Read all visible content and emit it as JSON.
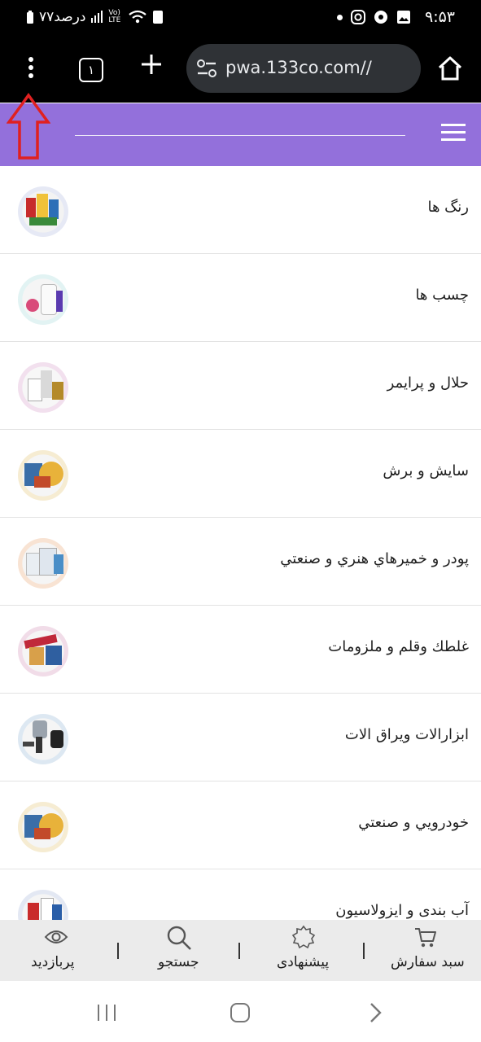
{
  "status_bar": {
    "time": "۹:۵۳",
    "battery": "۷۷درصد",
    "network": "Vo) LTE"
  },
  "browser": {
    "url": "pwa.133co.com//",
    "tab_count": "۱",
    "icons": [
      "menu-dots-icon",
      "tab-switcher-icon",
      "plus-icon",
      "site-settings-icon",
      "home-icon"
    ]
  },
  "annotation": {
    "color": "#e02020",
    "icon": "arrow-up-outline"
  },
  "header": {
    "background": "#9370db"
  },
  "categories": [
    {
      "label": "رنگ ها",
      "thumb": "paint-products"
    },
    {
      "label": "چسب ها",
      "thumb": "glue-products"
    },
    {
      "label": "حلال و پرايمر",
      "thumb": "solvent-primer"
    },
    {
      "label": "سايش و برش",
      "thumb": "abrasive-discs"
    },
    {
      "label": "پودر و خميرهاي هنري و صنعتي",
      "thumb": "powder-putty"
    },
    {
      "label": "غلطك وقلم و ملزومات",
      "thumb": "roller-brush"
    },
    {
      "label": "ابزارالات ويراق الات",
      "thumb": "tools-spraygun"
    },
    {
      "label": "خودرويي و صنعتي",
      "thumb": "automotive-abrasive"
    },
    {
      "label": "آب بندی و ايزولاسيون",
      "thumb": "sealants"
    }
  ],
  "bottom_nav": [
    {
      "label": "سبد سفارش",
      "icon": "cart-icon"
    },
    {
      "label": "پيشنهادی",
      "icon": "badge-icon"
    },
    {
      "label": "جستجو",
      "icon": "search-icon"
    },
    {
      "label": "پربازديد",
      "icon": "eye-icon"
    }
  ]
}
